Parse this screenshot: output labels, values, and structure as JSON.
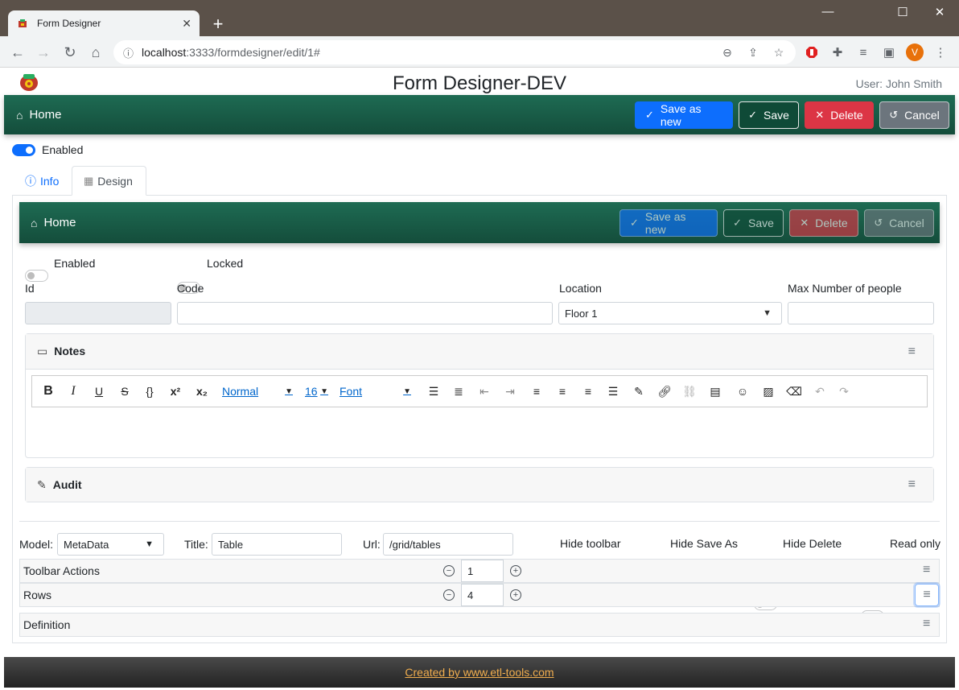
{
  "browser": {
    "tab_title": "Form Designer",
    "tab_close": "✕",
    "new_tab": "+",
    "url_host": "localhost",
    "url_path": ":3333/formdesigner/edit/1#",
    "profile_initial": "V",
    "win_min": "—",
    "win_max": "☐",
    "win_close": "✕"
  },
  "app": {
    "title": "Form Designer-DEV",
    "user": "User: John Smith",
    "nav_home": "Home",
    "save_as_new": "Save as new",
    "save": "Save",
    "delete": "Delete",
    "cancel": "Cancel",
    "enabled": "Enabled"
  },
  "tabs": {
    "info": "Info",
    "design": "Design"
  },
  "form": {
    "nav_home": "Home",
    "save_as_new": "Save as new",
    "save": "Save",
    "delete": "Delete",
    "cancel": "Cancel",
    "enabled": "Enabled",
    "locked": "Locked",
    "id_label": "Id",
    "code_label": "Code",
    "location_label": "Location",
    "location_value": "Floor 1",
    "max_label": "Max Number of people",
    "notes_title": "Notes",
    "audit_title": "Audit",
    "editor": {
      "header_select": "Normal",
      "size_select": "16",
      "font_select": "Font"
    }
  },
  "grid": {
    "model_label": "Model:",
    "model_value": "MetaData",
    "title_label": "Title:",
    "title_value": "Table",
    "url_label": "Url:",
    "url_value": "/grid/tables",
    "hide_toolbar": "Hide toolbar",
    "hide_save_as": "Hide Save As",
    "hide_delete": "Hide Delete",
    "read_only": "Read only",
    "rows": [
      {
        "label": "Toolbar Actions",
        "value": "1"
      },
      {
        "label": "Rows",
        "value": "4"
      },
      {
        "label": "Definition"
      }
    ]
  },
  "footer": {
    "link": "Created by www.etl-tools.com"
  },
  "colors": {
    "navbar": "#1e6b53",
    "primary": "#0d6efd",
    "danger": "#dc3545",
    "secondary": "#6c757d",
    "footer_link": "#f0ad4e"
  }
}
